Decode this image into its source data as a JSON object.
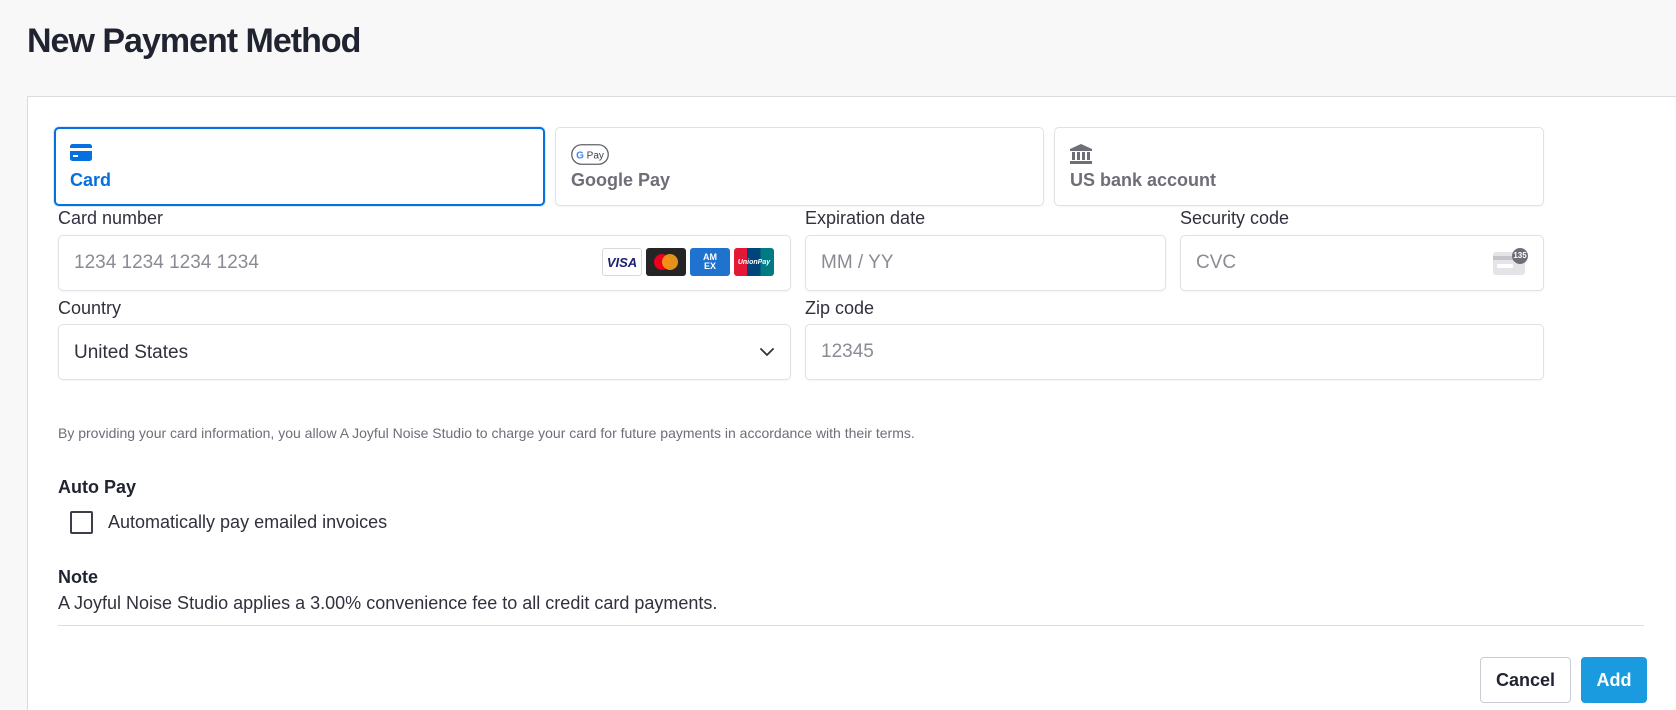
{
  "page": {
    "title": "New Payment Method"
  },
  "tabs": [
    {
      "label": "Card",
      "selected": true,
      "icon": "credit-card-icon"
    },
    {
      "label": "Google Pay",
      "selected": false,
      "icon": "google-pay-icon",
      "icon_text": "G Pay"
    },
    {
      "label": "US bank account",
      "selected": false,
      "icon": "bank-icon"
    }
  ],
  "card_number": {
    "label": "Card number",
    "placeholder": "1234 1234 1234 1234",
    "value": ""
  },
  "brands": [
    {
      "name": "visa-icon",
      "text": "VISA"
    },
    {
      "name": "mastercard-icon",
      "text": ""
    },
    {
      "name": "amex-icon",
      "text": "AM EX"
    },
    {
      "name": "unionpay-icon",
      "text": "UnionPay"
    }
  ],
  "expiration": {
    "label": "Expiration date",
    "placeholder": "MM / YY",
    "value": ""
  },
  "security": {
    "label": "Security code",
    "placeholder": "CVC",
    "value": "",
    "icon_text": "135"
  },
  "country": {
    "label": "Country",
    "value": "United States"
  },
  "zip": {
    "label": "Zip code",
    "placeholder": "12345",
    "value": ""
  },
  "consent_text": "By providing your card information, you allow A Joyful Noise Studio to charge your card for future payments in accordance with their terms.",
  "autopay": {
    "title": "Auto Pay",
    "checkbox_label": "Automatically pay emailed invoices",
    "checked": false
  },
  "note": {
    "title": "Note",
    "text": "A Joyful Noise Studio applies a 3.00% convenience fee to all credit card payments."
  },
  "buttons": {
    "cancel": "Cancel",
    "add": "Add"
  },
  "colors": {
    "accent": "#0570de",
    "add_button": "#1a9be0",
    "text": "#30313d",
    "muted": "#6d6e78"
  }
}
